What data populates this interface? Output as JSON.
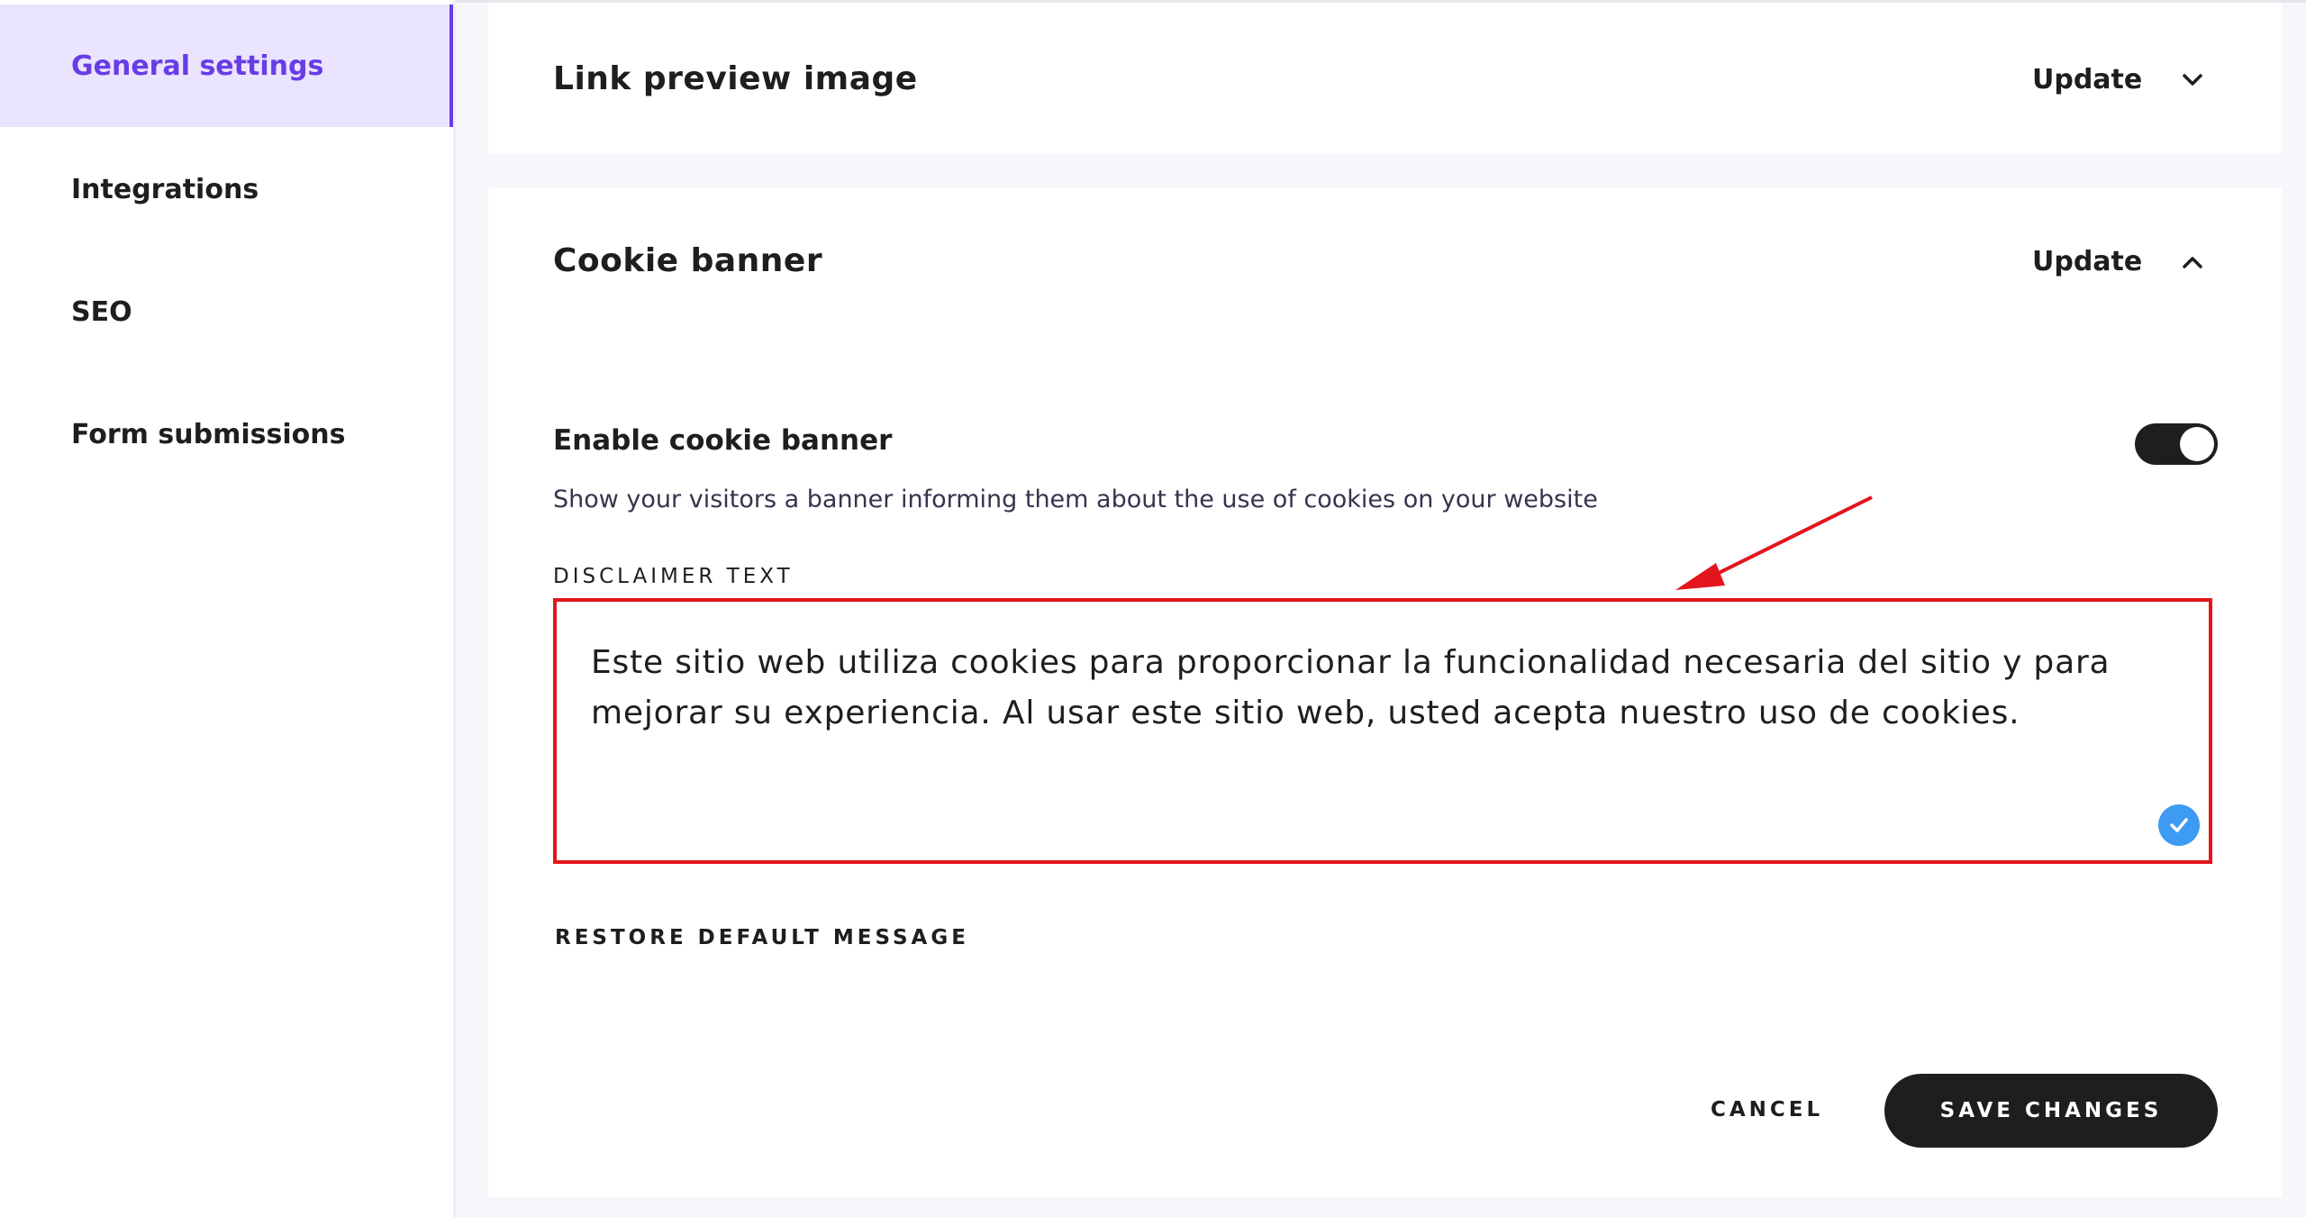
{
  "sidebar": {
    "items": [
      {
        "label": "General settings",
        "active": true
      },
      {
        "label": "Integrations"
      },
      {
        "label": "SEO"
      },
      {
        "label": "Form submissions"
      }
    ]
  },
  "link_preview": {
    "title": "Link preview image",
    "update_label": "Update",
    "chevron": "chevron-down-icon"
  },
  "cookie_banner": {
    "title": "Cookie banner",
    "update_label": "Update",
    "chevron": "chevron-up-icon",
    "enable_label": "Enable cookie banner",
    "enable_description": "Show your visitors a banner informing them about the use of cookies on your website",
    "toggle_on": true,
    "disclaimer_label": "DISCLAIMER TEXT",
    "disclaimer_text": "Este sitio web utiliza cookies para proporcionar la funcionalidad necesaria del sitio y para mejorar su experiencia. Al usar este sitio web, usted acepta nuestro uso de cookies.",
    "restore_label": "RESTORE DEFAULT MESSAGE",
    "cancel_label": "CANCEL",
    "save_label": "SAVE CHANGES"
  },
  "colors": {
    "accent": "#673de6",
    "accent_bg": "#ebe4ff",
    "annotation_red": "#e3161d",
    "check_blue": "#3d9bf3",
    "dark": "#1d1e20"
  }
}
